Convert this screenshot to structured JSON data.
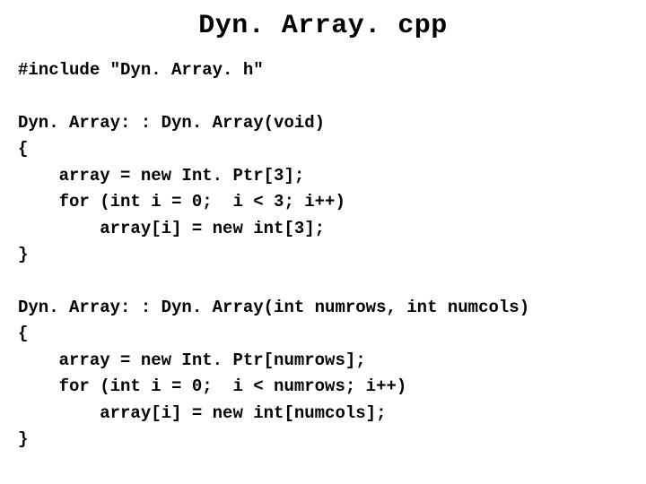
{
  "title": "Dyn. Array. cpp",
  "code_lines": [
    "#include \"Dyn. Array. h\"",
    "",
    "Dyn. Array: : Dyn. Array(void)",
    "{",
    "    array = new Int. Ptr[3];",
    "    for (int i = 0;  i < 3; i++)",
    "        array[i] = new int[3];",
    "}",
    "",
    "Dyn. Array: : Dyn. Array(int numrows, int numcols)",
    "{",
    "    array = new Int. Ptr[numrows];",
    "    for (int i = 0;  i < numrows; i++)",
    "        array[i] = new int[numcols];",
    "}"
  ]
}
